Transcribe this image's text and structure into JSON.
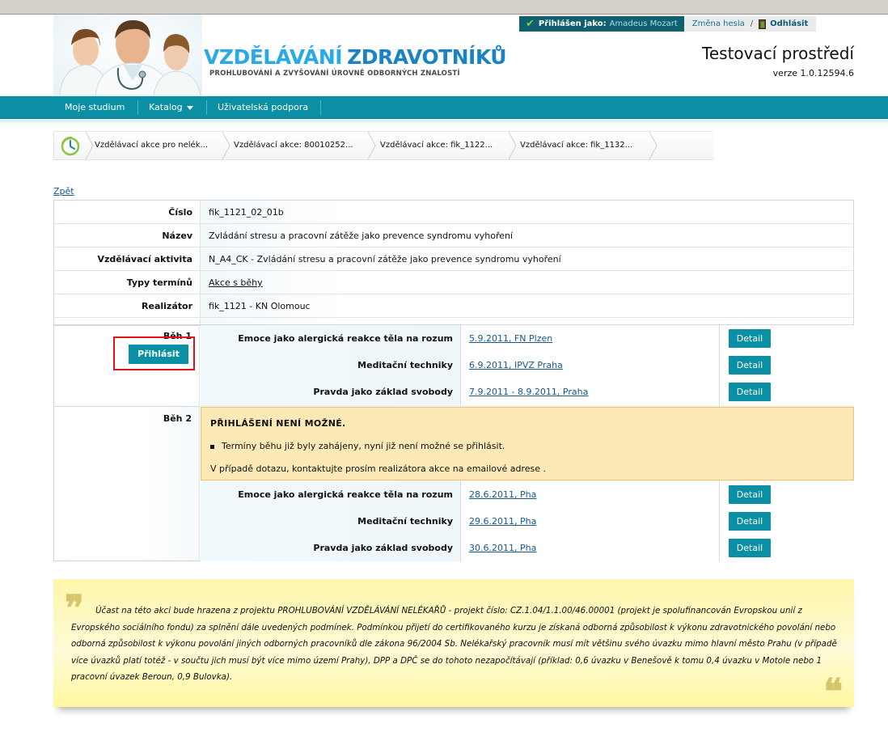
{
  "header": {
    "logo_line1": "VZDĚLÁVÁNÍ",
    "logo_line2": "ZDRAVOTNÍKŮ",
    "logo_sub": "PROHLUBOVÁNÍ A ZVYŠOVÁNÍ ÚROVNĚ ODBORNÝCH ZNALOSTÍ",
    "logged_in_label": "Přihlášen jako:",
    "logged_in_user": "Amadeus Mozart",
    "change_password": "Změna hesla",
    "separator": "/",
    "logout": "Odhlásit",
    "env_title": "Testovací prostředí",
    "version": "verze 1.0.12594.6"
  },
  "nav": {
    "items": [
      "Moje studium",
      "Katalog",
      "Uživatelská podpora"
    ]
  },
  "breadcrumb": [
    "Vzdělávací akce pro nelék...",
    "Vzdělávací akce: 80010252...",
    "Vzdělávací akce: fik_1122...",
    "Vzdělávací akce: fik_1132..."
  ],
  "back_link": "Zpět",
  "details": {
    "rows": [
      {
        "label": "Číslo",
        "value": "fik_1121_02_01b"
      },
      {
        "label": "Název",
        "value": "Zvládání stresu a pracovní zátěže jako prevence syndromu vyhoření"
      },
      {
        "label": "Vzdělávací aktivita",
        "value": "N_A4_CK - Zvládání stresu a pracovní zátěže jako prevence syndromu vyhoření"
      },
      {
        "label": "Typy termínů",
        "value": "Akce s běhy"
      },
      {
        "label": "Realizátor",
        "value": "fik_1121 - KN Olomouc"
      }
    ]
  },
  "runs": {
    "run1": {
      "label": "Běh 1",
      "signup_button": "Přihlásit",
      "terms": [
        {
          "name": "Emoce jako alergická reakce těla na rozum",
          "date": "5.9.2011, FN Plzen",
          "button": "Detail"
        },
        {
          "name": "Meditační techniky",
          "date": "6.9.2011, IPVZ Praha",
          "button": "Detail"
        },
        {
          "name": "Pravda jako základ svobody",
          "date": "7.9.2011 - 8.9.2011, Praha",
          "button": "Detail"
        }
      ]
    },
    "run2": {
      "label": "Běh 2",
      "warning_title": "PŘIHLÁŠENÍ NENÍ MOŽNÉ.",
      "warning_item": "Termíny běhu již byly zahájeny, nyní již není možné se přihlásit.",
      "warning_text": "V případě dotazu, kontaktujte prosím realizátora akce na emailové adrese .",
      "terms": [
        {
          "name": "Emoce jako alergická reakce těla na rozum",
          "date": "28.6.2011, Pha",
          "button": "Detail"
        },
        {
          "name": "Meditační techniky",
          "date": "29.6.2011, Pha",
          "button": "Detail"
        },
        {
          "name": "Pravda jako základ svobody",
          "date": "30.6.2011, Pha",
          "button": "Detail"
        }
      ]
    }
  },
  "note": {
    "text": "Účast na této akci bude hrazena z projektu PROHLUBOVÁNÍ VZDĚLÁVÁNÍ NELÉKAŘŮ - projekt číslo: CZ.1.04/1.1.00/46.00001 (projekt je spolufinancován Evropskou unií z Evropského sociálního fondu) za splnění dále uvedených podmínek. Podmínkou přijetí do certifikovaného kurzu je získaná odborná způsobilost k výkonu zdravotnického povolání nebo odborná způsobilost k výkonu povolání jiných odborných pracovníků dle zákona 96/2004 Sb.  Nelékařský pracovník musí mít většinu svého úvazku mimo hlavní město Prahu (v případě více úvazků platí totéž - v součtu jich musí být více mimo území Prahy), DPP a DPČ se do tohoto nezapočítávají (příklad: 0,6 úvazku v Benešově k tomu 0,4 úvazku v Motole nebo 1 pracovní úvazek Beroun, 0,9 Bulovka)."
  },
  "colors": {
    "teal": "#0b8fa4",
    "dark_teal": "#11606f",
    "highlight_red": "#e01414",
    "warning_bg": "#fde9b5",
    "note_bg": "#fdf5a9"
  }
}
